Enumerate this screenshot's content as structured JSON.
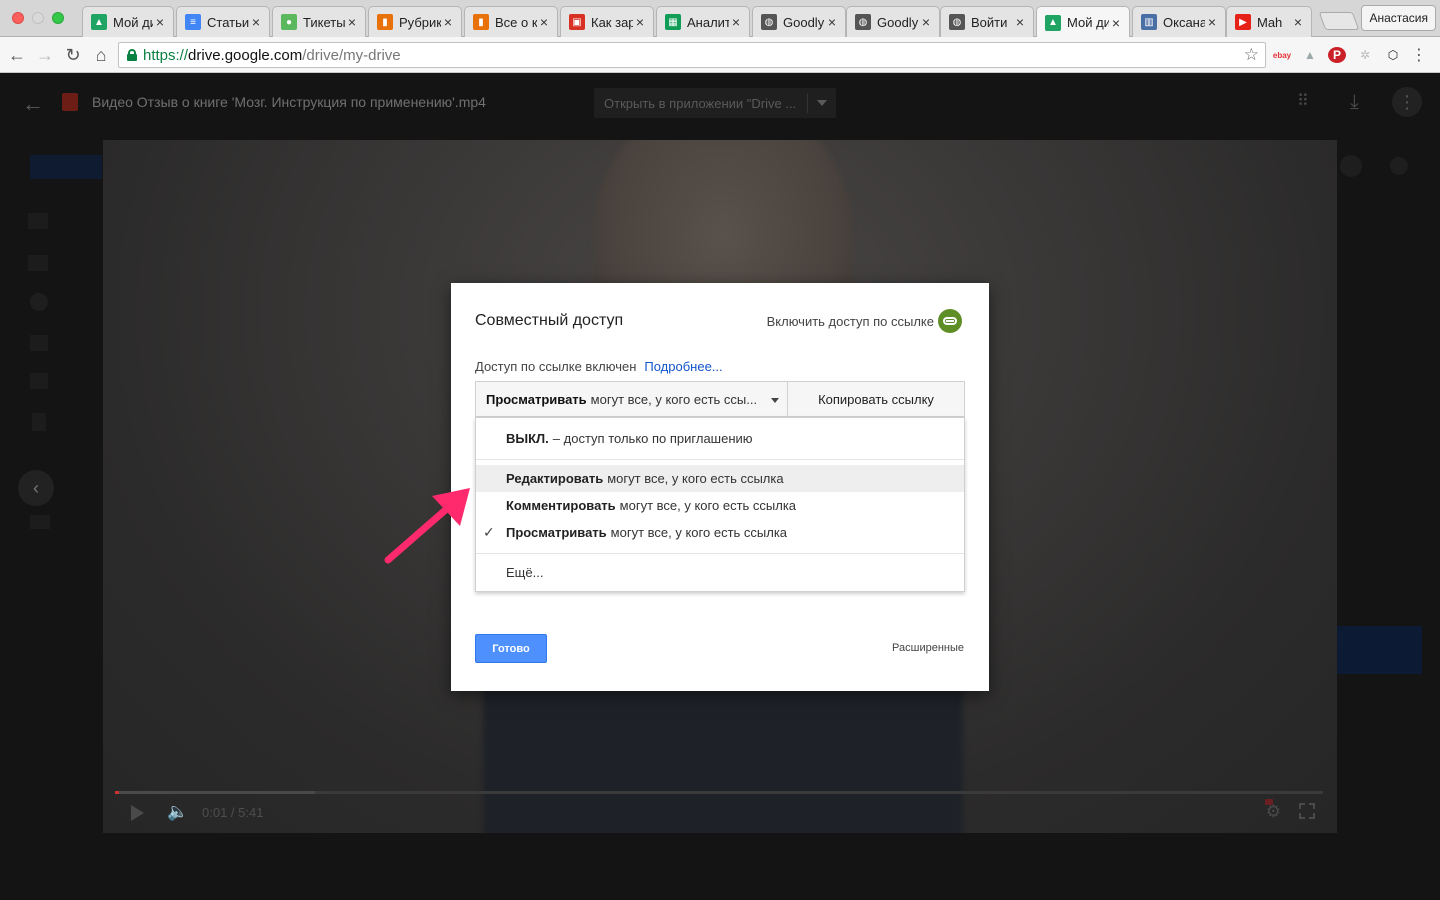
{
  "browser": {
    "tabs": [
      {
        "title": "Мой ди",
        "icon": "drive-icon",
        "color": "#1fa463"
      },
      {
        "title": "Статьи",
        "icon": "docs-icon",
        "color": "#4285f4"
      },
      {
        "title": "Тикеты",
        "icon": "tickets-icon",
        "color": "#5cb85c"
      },
      {
        "title": "Рубрик",
        "icon": "chart-icon",
        "color": "#e8710a"
      },
      {
        "title": "Все о к",
        "icon": "chart-icon",
        "color": "#e8710a"
      },
      {
        "title": "Как зар",
        "icon": "page-icon",
        "color": "#d93025"
      },
      {
        "title": "Аналит",
        "icon": "sheets-icon",
        "color": "#0f9d58"
      },
      {
        "title": "Goodly",
        "icon": "globe-icon",
        "color": "#555555"
      },
      {
        "title": "Goodly",
        "icon": "globe-icon",
        "color": "#555555"
      },
      {
        "title": "Войти",
        "icon": "globe-icon",
        "color": "#555555"
      },
      {
        "title": "Мой ди",
        "icon": "drive-icon",
        "color": "#1fa463",
        "active": true
      },
      {
        "title": "Оксана",
        "icon": "trello-icon",
        "color": "#4a6fa5"
      },
      {
        "title": "Mah",
        "icon": "youtube-icon",
        "color": "#e62117"
      }
    ],
    "profile_name": "Анастасия",
    "url": {
      "scheme": "https://",
      "host": "drive.google.com",
      "path": "/drive/my-drive"
    }
  },
  "viewer": {
    "file_title": "Видео Отзыв о книге 'Мозг. Инструкция по применению'.mp4",
    "open_with_label": "Открыть в приложении \"Drive ...",
    "video_time": "0:01 / 5:41",
    "progress": 0.003
  },
  "dialog": {
    "title": "Совместный доступ",
    "link_toggle_label": "Включить доступ по ссылке",
    "status_text": "Доступ по ссылке включен",
    "more_link": "Подробнее...",
    "select_bold": "Просматривать",
    "select_rest": "могут все, у кого есть ссы...",
    "copy_button": "Копировать ссылку",
    "menu": {
      "off_bold": "ВЫКЛ.",
      "off_rest": "– доступ только по приглашению",
      "edit_bold": "Редактировать",
      "edit_rest": "могут все, у кого есть ссылка",
      "comment_bold": "Комментировать",
      "comment_rest": "могут все, у кого есть ссылка",
      "view_bold": "Просматривать",
      "view_rest": "могут все, у кого есть ссылка",
      "more": "Ещё..."
    },
    "done_button": "Готово",
    "advanced": "Расширенные"
  },
  "colors": {
    "accent_blue": "#4d90fe",
    "link_green": "#5f8d26",
    "annotation": "#ff2a6d"
  }
}
